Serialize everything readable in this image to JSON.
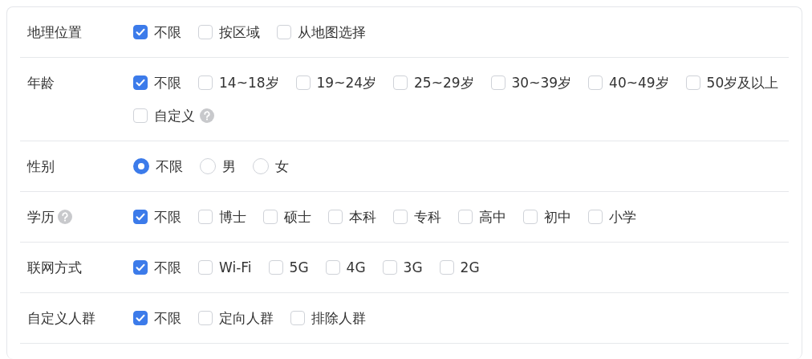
{
  "rows": [
    {
      "label": "地理位置",
      "help": false,
      "kind": "checkbox",
      "options": [
        {
          "label": "不限",
          "checked": true
        },
        {
          "label": "按区域",
          "checked": false
        },
        {
          "label": "从地图选择",
          "checked": false
        }
      ]
    },
    {
      "label": "年龄",
      "help": false,
      "kind": "checkbox",
      "options": [
        {
          "label": "不限",
          "checked": true
        },
        {
          "label": "14~18岁",
          "checked": false
        },
        {
          "label": "19~24岁",
          "checked": false
        },
        {
          "label": "25~29岁",
          "checked": false
        },
        {
          "label": "30~39岁",
          "checked": false
        },
        {
          "label": "40~49岁",
          "checked": false
        },
        {
          "label": "50岁及以上",
          "checked": false
        },
        {
          "label": "自定义",
          "checked": false,
          "help": true
        }
      ]
    },
    {
      "label": "性别",
      "help": false,
      "kind": "radio",
      "options": [
        {
          "label": "不限",
          "selected": true
        },
        {
          "label": "男",
          "selected": false
        },
        {
          "label": "女",
          "selected": false
        }
      ]
    },
    {
      "label": "学历",
      "help": true,
      "kind": "checkbox",
      "options": [
        {
          "label": "不限",
          "checked": true
        },
        {
          "label": "博士",
          "checked": false
        },
        {
          "label": "硕士",
          "checked": false
        },
        {
          "label": "本科",
          "checked": false
        },
        {
          "label": "专科",
          "checked": false
        },
        {
          "label": "高中",
          "checked": false
        },
        {
          "label": "初中",
          "checked": false
        },
        {
          "label": "小学",
          "checked": false
        }
      ]
    },
    {
      "label": "联网方式",
      "help": false,
      "kind": "checkbox",
      "options": [
        {
          "label": "不限",
          "checked": true
        },
        {
          "label": "Wi-Fi",
          "checked": false
        },
        {
          "label": "5G",
          "checked": false
        },
        {
          "label": "4G",
          "checked": false
        },
        {
          "label": "3G",
          "checked": false
        },
        {
          "label": "2G",
          "checked": false
        }
      ]
    },
    {
      "label": "自定义人群",
      "help": false,
      "kind": "checkbox",
      "options": [
        {
          "label": "不限",
          "checked": true
        },
        {
          "label": "定向人群",
          "checked": false
        },
        {
          "label": "排除人群",
          "checked": false
        }
      ]
    }
  ]
}
